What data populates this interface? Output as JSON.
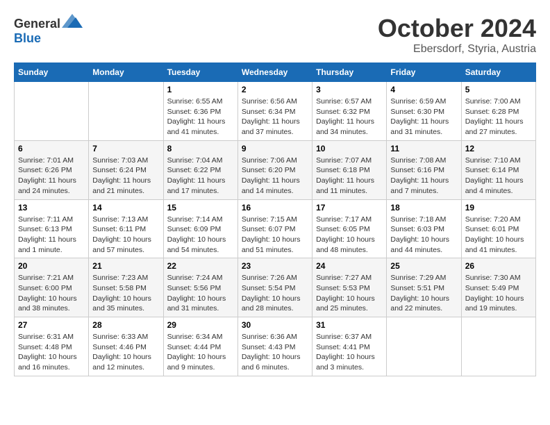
{
  "header": {
    "logo": {
      "text_general": "General",
      "text_blue": "Blue"
    },
    "title": "October 2024",
    "location": "Ebersdorf, Styria, Austria"
  },
  "weekdays": [
    "Sunday",
    "Monday",
    "Tuesday",
    "Wednesday",
    "Thursday",
    "Friday",
    "Saturday"
  ],
  "weeks": [
    [
      {
        "day": "",
        "sunrise": "",
        "sunset": "",
        "daylight": ""
      },
      {
        "day": "",
        "sunrise": "",
        "sunset": "",
        "daylight": ""
      },
      {
        "day": "1",
        "sunrise": "Sunrise: 6:55 AM",
        "sunset": "Sunset: 6:36 PM",
        "daylight": "Daylight: 11 hours and 41 minutes."
      },
      {
        "day": "2",
        "sunrise": "Sunrise: 6:56 AM",
        "sunset": "Sunset: 6:34 PM",
        "daylight": "Daylight: 11 hours and 37 minutes."
      },
      {
        "day": "3",
        "sunrise": "Sunrise: 6:57 AM",
        "sunset": "Sunset: 6:32 PM",
        "daylight": "Daylight: 11 hours and 34 minutes."
      },
      {
        "day": "4",
        "sunrise": "Sunrise: 6:59 AM",
        "sunset": "Sunset: 6:30 PM",
        "daylight": "Daylight: 11 hours and 31 minutes."
      },
      {
        "day": "5",
        "sunrise": "Sunrise: 7:00 AM",
        "sunset": "Sunset: 6:28 PM",
        "daylight": "Daylight: 11 hours and 27 minutes."
      }
    ],
    [
      {
        "day": "6",
        "sunrise": "Sunrise: 7:01 AM",
        "sunset": "Sunset: 6:26 PM",
        "daylight": "Daylight: 11 hours and 24 minutes."
      },
      {
        "day": "7",
        "sunrise": "Sunrise: 7:03 AM",
        "sunset": "Sunset: 6:24 PM",
        "daylight": "Daylight: 11 hours and 21 minutes."
      },
      {
        "day": "8",
        "sunrise": "Sunrise: 7:04 AM",
        "sunset": "Sunset: 6:22 PM",
        "daylight": "Daylight: 11 hours and 17 minutes."
      },
      {
        "day": "9",
        "sunrise": "Sunrise: 7:06 AM",
        "sunset": "Sunset: 6:20 PM",
        "daylight": "Daylight: 11 hours and 14 minutes."
      },
      {
        "day": "10",
        "sunrise": "Sunrise: 7:07 AM",
        "sunset": "Sunset: 6:18 PM",
        "daylight": "Daylight: 11 hours and 11 minutes."
      },
      {
        "day": "11",
        "sunrise": "Sunrise: 7:08 AM",
        "sunset": "Sunset: 6:16 PM",
        "daylight": "Daylight: 11 hours and 7 minutes."
      },
      {
        "day": "12",
        "sunrise": "Sunrise: 7:10 AM",
        "sunset": "Sunset: 6:14 PM",
        "daylight": "Daylight: 11 hours and 4 minutes."
      }
    ],
    [
      {
        "day": "13",
        "sunrise": "Sunrise: 7:11 AM",
        "sunset": "Sunset: 6:13 PM",
        "daylight": "Daylight: 11 hours and 1 minute."
      },
      {
        "day": "14",
        "sunrise": "Sunrise: 7:13 AM",
        "sunset": "Sunset: 6:11 PM",
        "daylight": "Daylight: 10 hours and 57 minutes."
      },
      {
        "day": "15",
        "sunrise": "Sunrise: 7:14 AM",
        "sunset": "Sunset: 6:09 PM",
        "daylight": "Daylight: 10 hours and 54 minutes."
      },
      {
        "day": "16",
        "sunrise": "Sunrise: 7:15 AM",
        "sunset": "Sunset: 6:07 PM",
        "daylight": "Daylight: 10 hours and 51 minutes."
      },
      {
        "day": "17",
        "sunrise": "Sunrise: 7:17 AM",
        "sunset": "Sunset: 6:05 PM",
        "daylight": "Daylight: 10 hours and 48 minutes."
      },
      {
        "day": "18",
        "sunrise": "Sunrise: 7:18 AM",
        "sunset": "Sunset: 6:03 PM",
        "daylight": "Daylight: 10 hours and 44 minutes."
      },
      {
        "day": "19",
        "sunrise": "Sunrise: 7:20 AM",
        "sunset": "Sunset: 6:01 PM",
        "daylight": "Daylight: 10 hours and 41 minutes."
      }
    ],
    [
      {
        "day": "20",
        "sunrise": "Sunrise: 7:21 AM",
        "sunset": "Sunset: 6:00 PM",
        "daylight": "Daylight: 10 hours and 38 minutes."
      },
      {
        "day": "21",
        "sunrise": "Sunrise: 7:23 AM",
        "sunset": "Sunset: 5:58 PM",
        "daylight": "Daylight: 10 hours and 35 minutes."
      },
      {
        "day": "22",
        "sunrise": "Sunrise: 7:24 AM",
        "sunset": "Sunset: 5:56 PM",
        "daylight": "Daylight: 10 hours and 31 minutes."
      },
      {
        "day": "23",
        "sunrise": "Sunrise: 7:26 AM",
        "sunset": "Sunset: 5:54 PM",
        "daylight": "Daylight: 10 hours and 28 minutes."
      },
      {
        "day": "24",
        "sunrise": "Sunrise: 7:27 AM",
        "sunset": "Sunset: 5:53 PM",
        "daylight": "Daylight: 10 hours and 25 minutes."
      },
      {
        "day": "25",
        "sunrise": "Sunrise: 7:29 AM",
        "sunset": "Sunset: 5:51 PM",
        "daylight": "Daylight: 10 hours and 22 minutes."
      },
      {
        "day": "26",
        "sunrise": "Sunrise: 7:30 AM",
        "sunset": "Sunset: 5:49 PM",
        "daylight": "Daylight: 10 hours and 19 minutes."
      }
    ],
    [
      {
        "day": "27",
        "sunrise": "Sunrise: 6:31 AM",
        "sunset": "Sunset: 4:48 PM",
        "daylight": "Daylight: 10 hours and 16 minutes."
      },
      {
        "day": "28",
        "sunrise": "Sunrise: 6:33 AM",
        "sunset": "Sunset: 4:46 PM",
        "daylight": "Daylight: 10 hours and 12 minutes."
      },
      {
        "day": "29",
        "sunrise": "Sunrise: 6:34 AM",
        "sunset": "Sunset: 4:44 PM",
        "daylight": "Daylight: 10 hours and 9 minutes."
      },
      {
        "day": "30",
        "sunrise": "Sunrise: 6:36 AM",
        "sunset": "Sunset: 4:43 PM",
        "daylight": "Daylight: 10 hours and 6 minutes."
      },
      {
        "day": "31",
        "sunrise": "Sunrise: 6:37 AM",
        "sunset": "Sunset: 4:41 PM",
        "daylight": "Daylight: 10 hours and 3 minutes."
      },
      {
        "day": "",
        "sunrise": "",
        "sunset": "",
        "daylight": ""
      },
      {
        "day": "",
        "sunrise": "",
        "sunset": "",
        "daylight": ""
      }
    ]
  ]
}
